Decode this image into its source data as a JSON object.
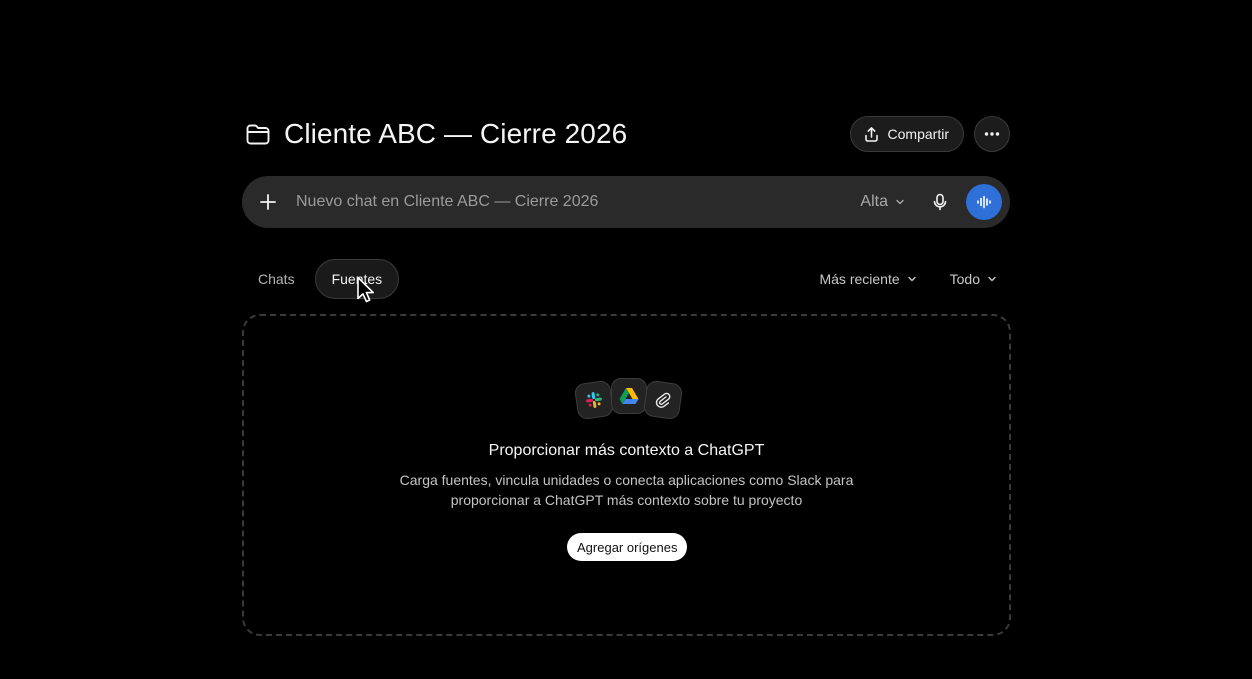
{
  "project": {
    "title": "Cliente ABC — Cierre 2026",
    "icon": "folder-icon"
  },
  "header": {
    "share_label": "Compartir",
    "share_icon": "share-icon",
    "more_icon": "more-horizontal-icon"
  },
  "composer": {
    "placeholder": "Nuevo chat en Cliente ABC — Cierre 2026",
    "value": "",
    "model_label": "Alta",
    "voice_button_color": "#2e6fd8"
  },
  "tabs": [
    {
      "label": "Chats",
      "active": false
    },
    {
      "label": "Fuentes",
      "active": true
    }
  ],
  "filters": {
    "sort_label": "Más reciente",
    "scope_label": "Todo"
  },
  "empty_state": {
    "app_icons": [
      "slack-icon",
      "google-drive-icon",
      "paperclip-icon"
    ],
    "title": "Proporcionar más contexto a ChatGPT",
    "description": "Carga fuentes, vincula unidades o conecta aplicaciones como Slack para proporcionar a ChatGPT más contexto sobre tu proyecto",
    "button_label": "Agregar orígenes"
  }
}
